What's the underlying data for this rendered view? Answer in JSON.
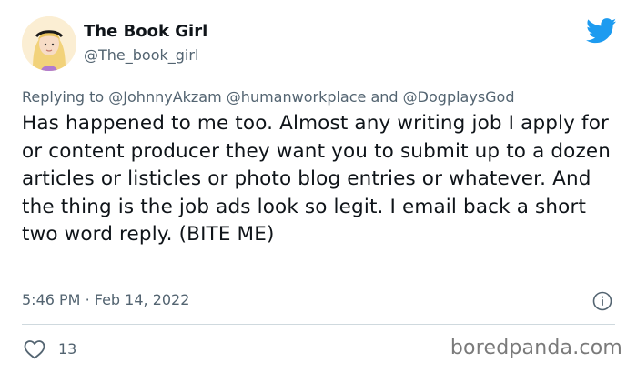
{
  "author": {
    "display_name": "The Book Girl",
    "handle": "@The_book_girl"
  },
  "reply": {
    "prefix": "Replying to",
    "mentions": [
      "@JohnnyAkzam",
      "@humanworkplace",
      "@DogplaysGod"
    ],
    "joiner": "and"
  },
  "tweet": {
    "text": "Has happened to me too. Almost any writing job I apply for or content producer they want you to submit up to a dozen articles or listicles or photo blog entries or whatever. And the thing is the job ads look so legit. I email back a short two word reply. (BITE ME)",
    "time": "5:46 PM",
    "separator": "·",
    "date": "Feb 14, 2022"
  },
  "actions": {
    "like_count": "13"
  },
  "watermark": "boredpanda.com",
  "colors": {
    "twitter_blue": "#1d9bf0",
    "secondary_text": "#536471",
    "divider": "#cfd9de"
  },
  "icons": {
    "logo": "twitter-bird-icon",
    "info": "info-icon",
    "like": "heart-outline-icon"
  }
}
